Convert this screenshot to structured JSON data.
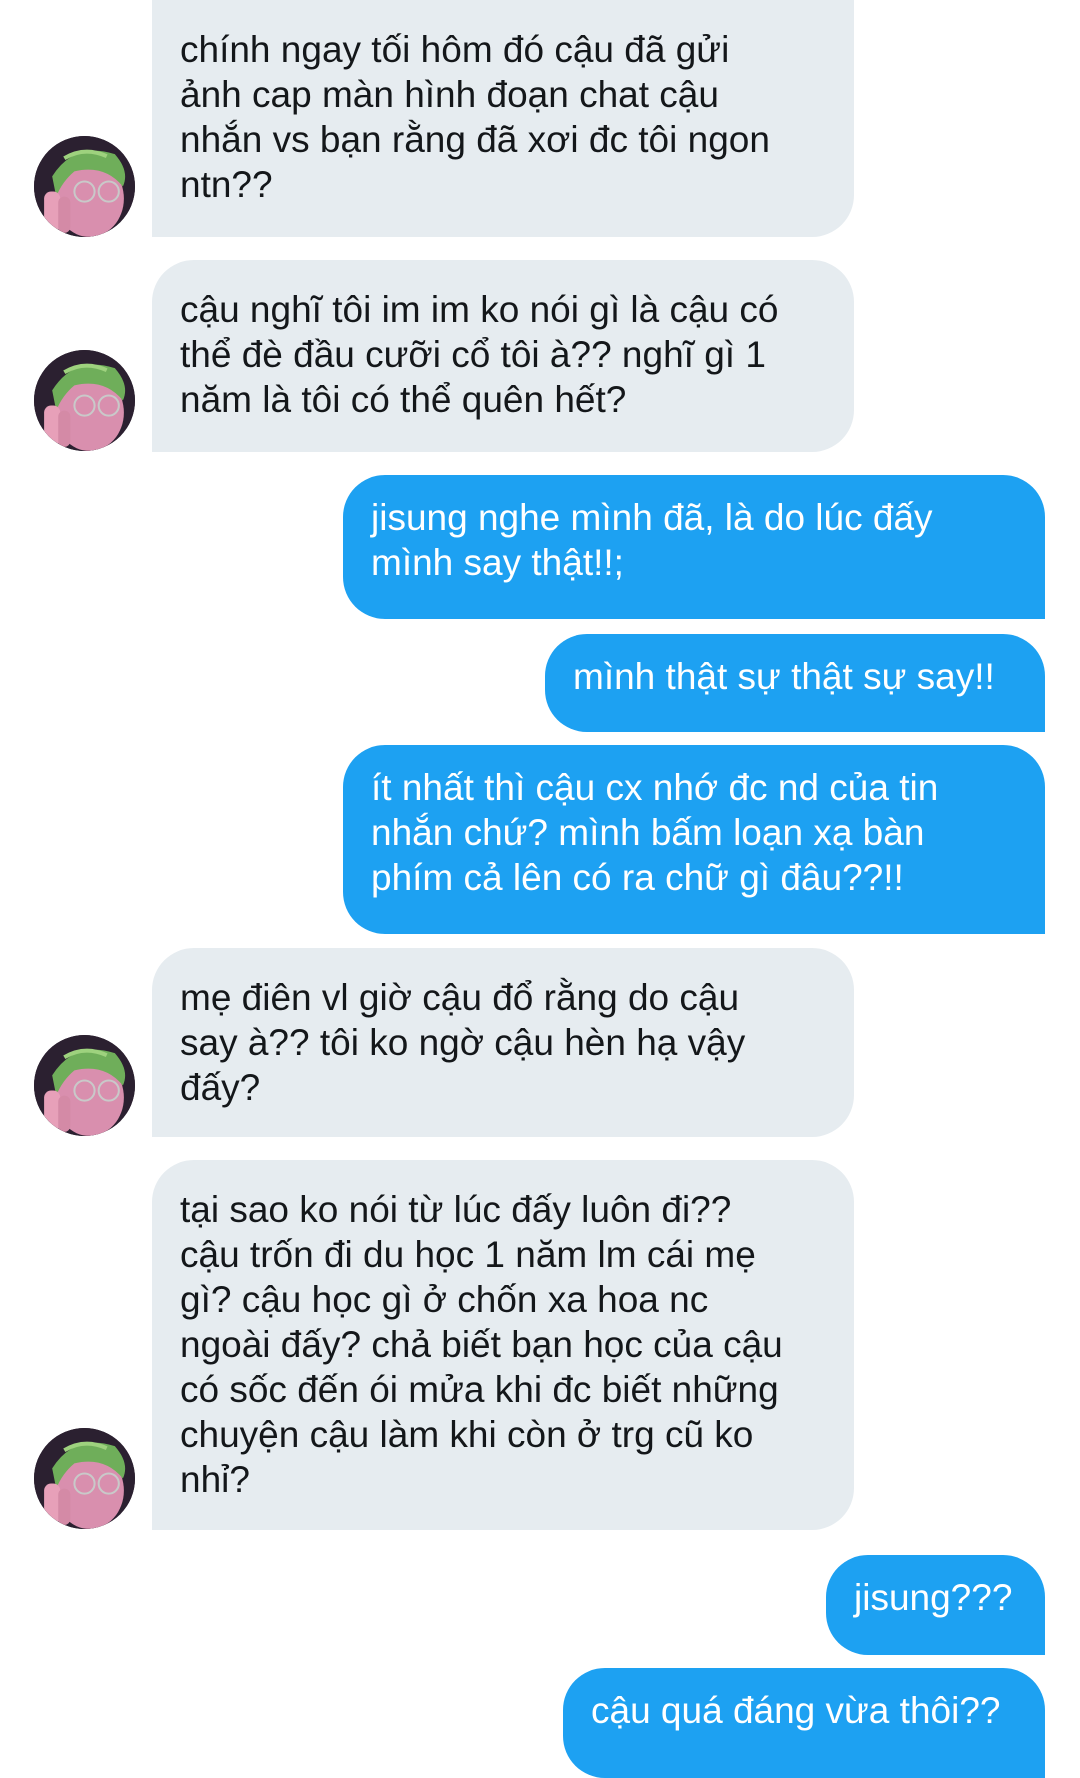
{
  "conversation": {
    "messages": [
      {
        "direction": "received",
        "text": "chính ngay tối hôm đó cậu đã gửi\nảnh cap màn hình đoạn chat cậu\nnhắn vs bạn rằng đã xơi đc tôi ngon\nntn??"
      },
      {
        "direction": "received",
        "text": "cậu nghĩ tôi im im ko nói gì là cậu có\nthể đè đầu cưỡi cổ tôi à?? nghĩ gì 1\nnăm là tôi có thể quên hết?"
      },
      {
        "direction": "sent",
        "text": "jisung nghe mình đã, là do lúc đấy\nmình say thật!!;"
      },
      {
        "direction": "sent",
        "text": "mình thật sự thật sự say!!"
      },
      {
        "direction": "sent",
        "text": "ít nhất thì cậu cx nhớ đc nd của tin\nnhắn chứ? mình bấm loạn xạ bàn\nphím cả lên có ra chữ gì đâu??!!"
      },
      {
        "direction": "received",
        "text": "mẹ điên vl giờ cậu đổ rằng do cậu\nsay à?? tôi ko ngờ cậu hèn hạ vậy\nđấy?"
      },
      {
        "direction": "received",
        "text": "tại sao ko nói từ lúc đấy luôn đi??\ncậu trốn đi du học 1 năm lm cái mẹ\ngì? cậu học gì ở chốn xa hoa nc\nngoài đấy? chả biết bạn học của cậu\ncó sốc đến ói mửa khi đc biết những\nchuyện cậu làm khi còn ở trg cũ ko\nnhỉ?"
      },
      {
        "direction": "sent",
        "text": "jisung???"
      },
      {
        "direction": "sent",
        "text": "cậu quá đáng vừa thôi??"
      }
    ]
  },
  "colors": {
    "received_bubble": "#e6ecf0",
    "received_text": "#14171a",
    "sent_bubble": "#1da1f2",
    "sent_text": "#ffffff",
    "background": "#ffffff"
  },
  "icons": {
    "avatar": "contact-avatar-photo"
  }
}
